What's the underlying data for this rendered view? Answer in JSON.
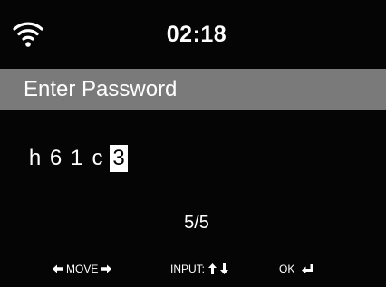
{
  "status_bar": {
    "wifi_icon": "wifi-icon",
    "time": "02:18"
  },
  "header": {
    "title": "Enter Password"
  },
  "password": {
    "characters": [
      "h",
      "6",
      "1",
      "c"
    ],
    "cursor_char": "3"
  },
  "counter": "5/5",
  "hints": {
    "move_label": "MOVE",
    "input_label": "INPUT:",
    "ok_label": "OK"
  },
  "colors": {
    "background": "#050505",
    "title_bar": "#7a7a7a",
    "text": "#ffffff",
    "cursor_bg": "#ffffff"
  }
}
